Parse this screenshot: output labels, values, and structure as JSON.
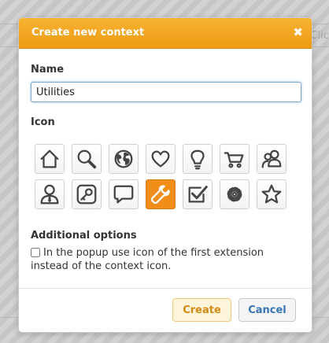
{
  "background": {
    "fragment_text": "Clic"
  },
  "dialog": {
    "title": "Create new context",
    "close_glyph": "✖",
    "name_label": "Name",
    "name_value": "Utilities",
    "icon_label": "Icon",
    "icons": [
      {
        "name": "home-icon"
      },
      {
        "name": "search-icon"
      },
      {
        "name": "globe-icon"
      },
      {
        "name": "heart-icon"
      },
      {
        "name": "lightbulb-icon"
      },
      {
        "name": "shopping-cart-icon"
      },
      {
        "name": "users-icon"
      },
      {
        "name": "person-icon"
      },
      {
        "name": "key-icon"
      },
      {
        "name": "speech-bubble-icon"
      },
      {
        "name": "wrench-icon",
        "selected": true
      },
      {
        "name": "checkbox-icon"
      },
      {
        "name": "gear-icon"
      },
      {
        "name": "star-icon"
      }
    ],
    "options_label": "Additional options",
    "option_text": "In the popup use icon of the first extension instead of the context icon.",
    "option_checked": false,
    "create_label": "Create",
    "cancel_label": "Cancel"
  },
  "colors": {
    "accent": "#f5a623",
    "selected_icon": "#f28d1a",
    "create_text": "#d38a14",
    "cancel_text": "#3776b4"
  }
}
